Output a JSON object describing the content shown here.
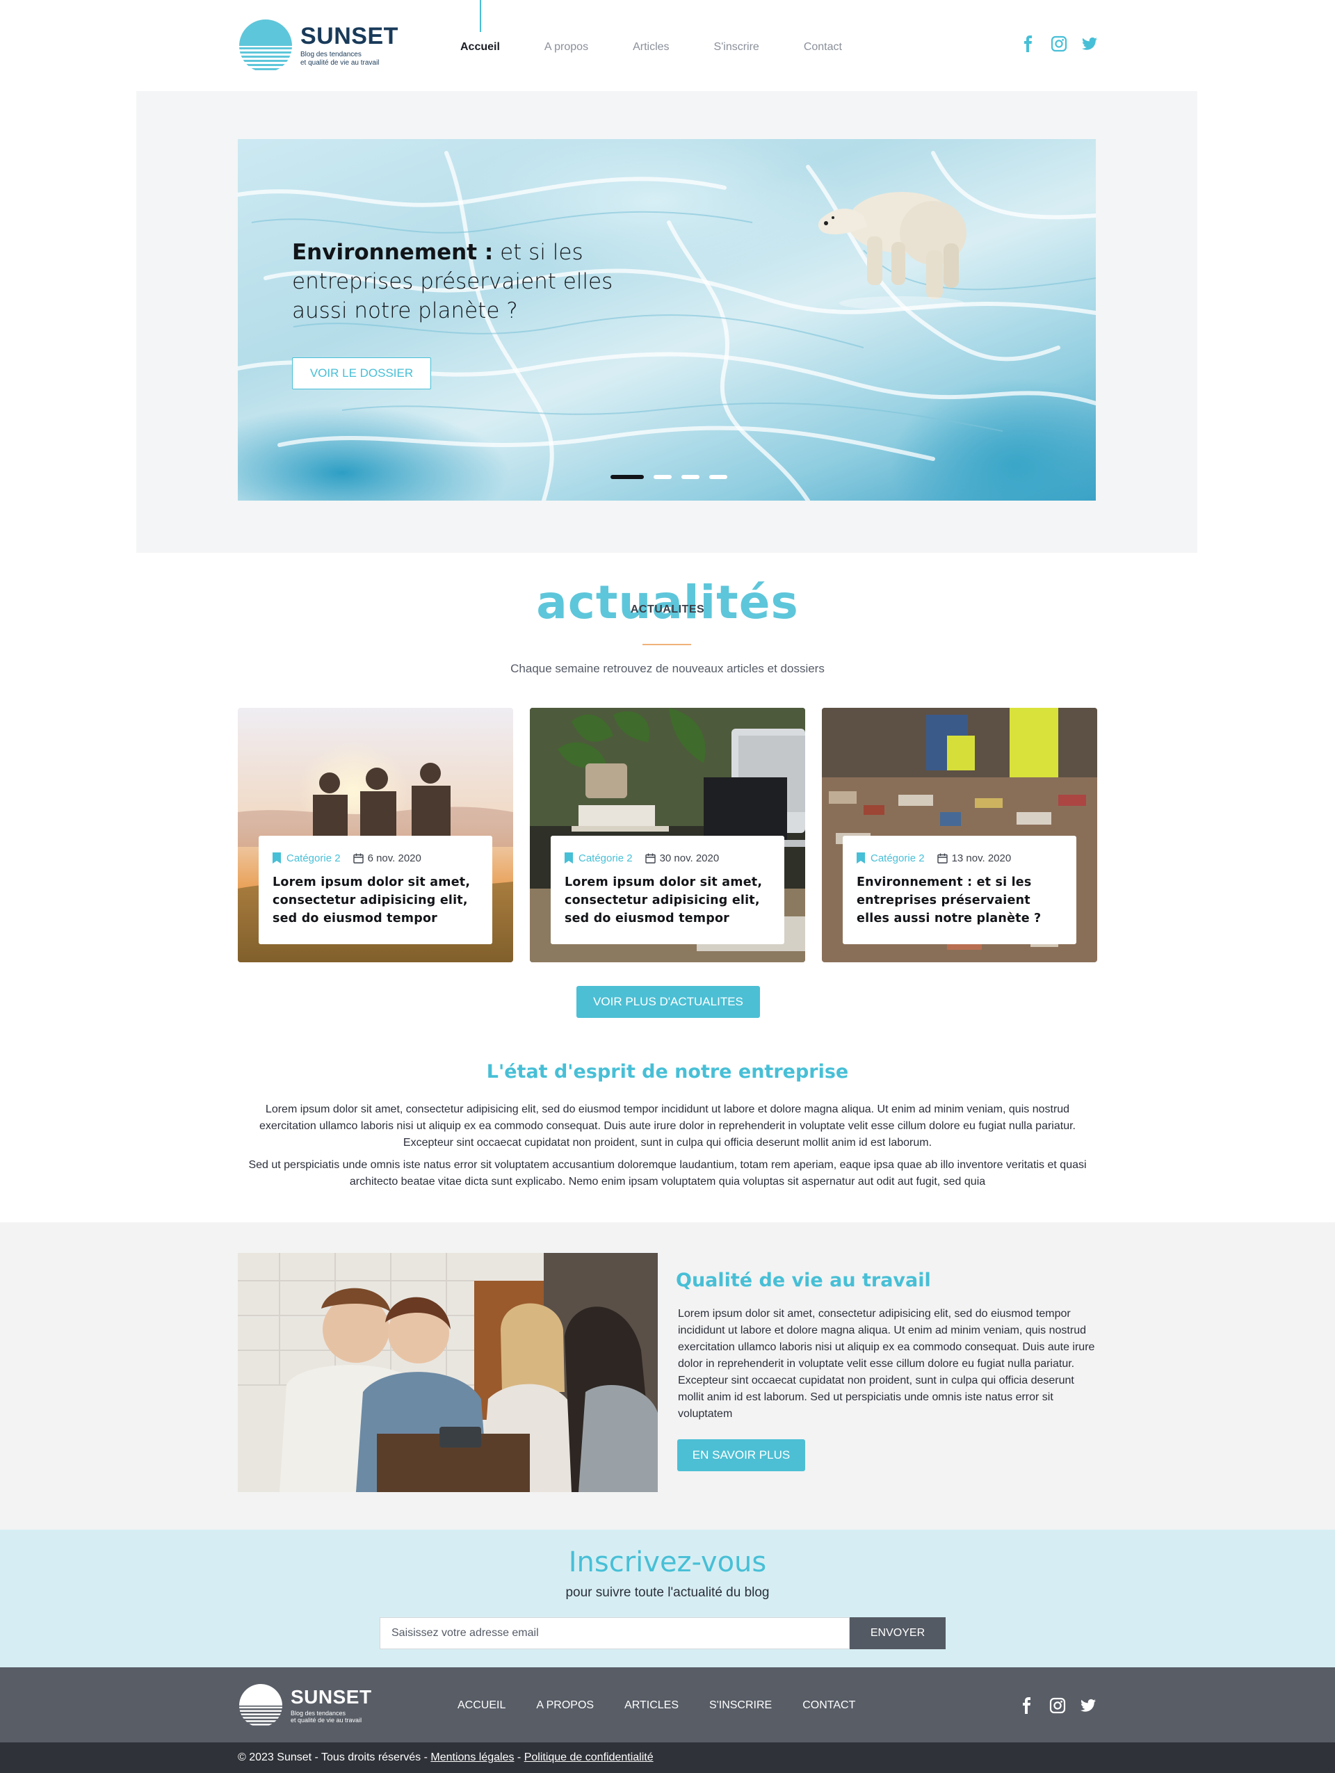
{
  "brand": {
    "name": "SUNSET",
    "tagline_line1": "Blog des tendances",
    "tagline_line2": "et qualité de vie au travail",
    "accent_color": "#47bfd6",
    "dark_color": "#193a59"
  },
  "nav": {
    "items": [
      {
        "label": "Accueil",
        "active": true
      },
      {
        "label": "A propos",
        "active": false
      },
      {
        "label": "Articles",
        "active": false
      },
      {
        "label": "S'inscrire",
        "active": false
      },
      {
        "label": "Contact",
        "active": false
      }
    ]
  },
  "social": [
    "facebook-icon",
    "instagram-icon",
    "twitter-icon"
  ],
  "hero": {
    "title_bold": "Environnement :",
    "title_rest": " et si les entreprises préservaient elles aussi notre planète ?",
    "button_label": "VOIR LE DOSSIER",
    "slides_count": 4,
    "active_slide": 1
  },
  "news": {
    "title_decorative": "actualités",
    "title": "ACTUALITES",
    "subtitle": "Chaque semaine retrouvez de nouveaux articles et dossiers",
    "cards": [
      {
        "category": "Catégorie 2",
        "date": "6 nov. 2020",
        "title": "Lorem ipsum dolor sit amet, consectetur adipisicing elit, sed do eiusmod tempor"
      },
      {
        "category": "Catégorie 2",
        "date": "30 nov. 2020",
        "title": "Lorem ipsum dolor sit amet, consectetur adipisicing elit, sed do eiusmod tempor"
      },
      {
        "category": "Catégorie 2",
        "date": "13 nov. 2020",
        "title": "Environnement : et si les entreprises préservaient elles aussi notre planète ?"
      }
    ],
    "more_label": "VOIR PLUS D'ACTUALITES"
  },
  "esprit": {
    "title": "L'état d'esprit de notre entreprise",
    "p1": "Lorem ipsum dolor sit amet, consectetur adipisicing elit, sed do eiusmod tempor incididunt ut labore et dolore magna aliqua. Ut enim ad minim veniam, quis nostrud exercitation ullamco laboris nisi ut aliquip ex ea commodo consequat. Duis aute irure dolor in reprehenderit in voluptate velit esse cillum dolore eu fugiat nulla pariatur. Excepteur sint occaecat cupidatat non proident, sunt in culpa qui officia deserunt mollit anim id est laborum.",
    "p2": "Sed ut perspiciatis unde omnis iste natus error sit voluptatem accusantium doloremque laudantium, totam rem aperiam, eaque ipsa quae ab illo inventore veritatis et quasi architecto beatae vitae dicta sunt explicabo. Nemo enim ipsam voluptatem quia voluptas sit aspernatur aut odit aut fugit, sed quia"
  },
  "qvt": {
    "title": "Qualité de vie au travail",
    "text": "Lorem ipsum dolor sit amet, consectetur adipisicing elit, sed do eiusmod tempor incididunt ut labore et dolore magna aliqua. Ut enim ad minim veniam, quis nostrud exercitation ullamco laboris nisi ut aliquip ex ea commodo consequat. Duis aute irure dolor in reprehenderit in voluptate velit esse cillum dolore eu fugiat nulla pariatur. Excepteur sint occaecat cupidatat non proident, sunt in culpa qui officia deserunt mollit anim id est laborum. Sed ut perspiciatis unde omnis iste natus error sit voluptatem",
    "button_label": "EN SAVOIR PLUS"
  },
  "newsletter": {
    "title": "Inscrivez-vous",
    "subtitle": "pour suivre toute l'actualité du blog",
    "placeholder": "Saisissez votre adresse email",
    "value": "",
    "button_label": "ENVOYER"
  },
  "footer": {
    "nav": [
      "ACCUEIL",
      "A PROPOS",
      "ARTICLES",
      "S'INSCRIRE",
      "CONTACT"
    ],
    "copyright": "© 2023 Sunset - Tous droits réservés - ",
    "legal_label": "Mentions légales",
    "separator": " - ",
    "privacy_label": "Politique de confidentialité"
  }
}
